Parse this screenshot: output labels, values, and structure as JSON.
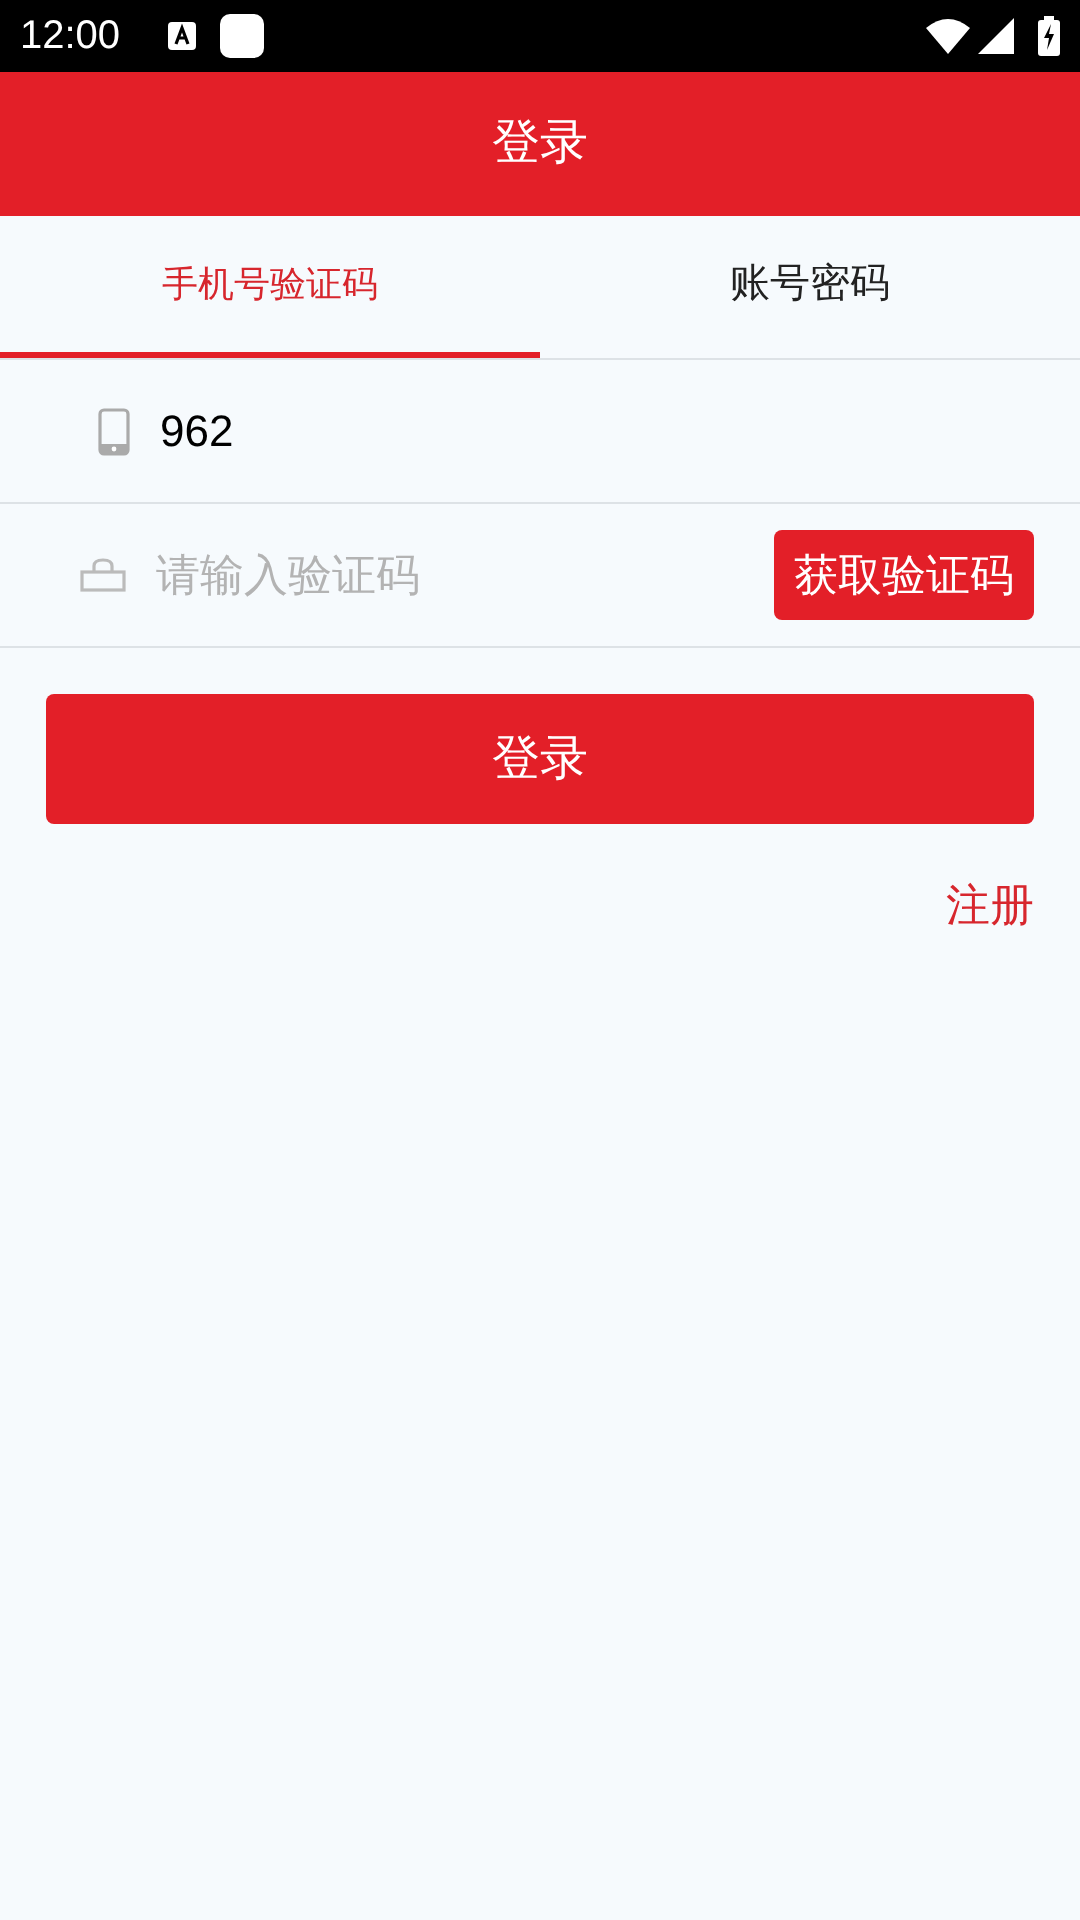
{
  "status_bar": {
    "time": "12:00"
  },
  "header": {
    "title": "登录"
  },
  "tabs": [
    {
      "label": "手机号验证码",
      "selected": true
    },
    {
      "label": "账号密码",
      "selected": false
    }
  ],
  "phone_field": {
    "value": "962"
  },
  "code_field": {
    "placeholder": "请输入验证码",
    "button": "获取验证码"
  },
  "login_button": "登录",
  "register_link": "注册"
}
